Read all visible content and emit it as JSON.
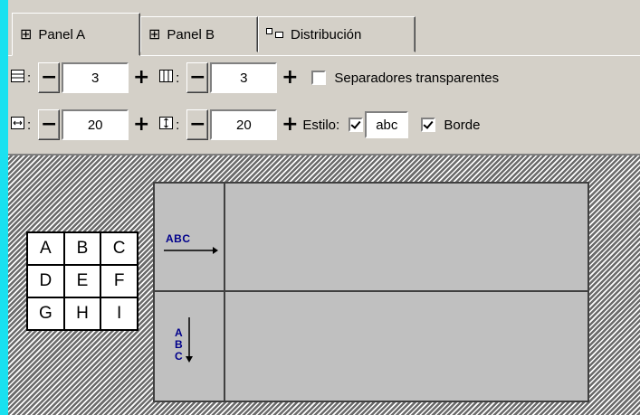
{
  "tabs": [
    {
      "label": "Panel A",
      "icon": "four-panels-icon",
      "active": true
    },
    {
      "label": "Panel B",
      "icon": "four-panels-icon",
      "active": false
    },
    {
      "label": "Distribución",
      "icon": "distribution-icon",
      "active": false
    }
  ],
  "controls": {
    "rows": {
      "icon": "rows-icon",
      "value": "3"
    },
    "columns": {
      "icon": "columns-icon",
      "value": "3"
    },
    "transparent_separators": {
      "label": "Separadores transparentes",
      "checked": false
    },
    "width": {
      "icon": "horizontal-spacing-icon",
      "value": "20"
    },
    "height": {
      "icon": "vertical-spacing-icon",
      "value": "20"
    },
    "style": {
      "label": "Estilo:",
      "checked": true,
      "sample": "abc"
    },
    "border": {
      "label": "Borde",
      "checked": true
    }
  },
  "spin": {
    "minus": "−",
    "plus": "+"
  },
  "preview": {
    "grid_cells": [
      "A",
      "B",
      "C",
      "D",
      "E",
      "F",
      "G",
      "H",
      "I"
    ],
    "horizontal_text_sample": "ABC",
    "vertical_text_sample": [
      "A",
      "B",
      "C"
    ]
  },
  "colors": {
    "face": "#d4d0c8",
    "accent_edge": "#19e1f0",
    "sample_text": "#00008b",
    "pane_fill": "#c0c0c0"
  }
}
